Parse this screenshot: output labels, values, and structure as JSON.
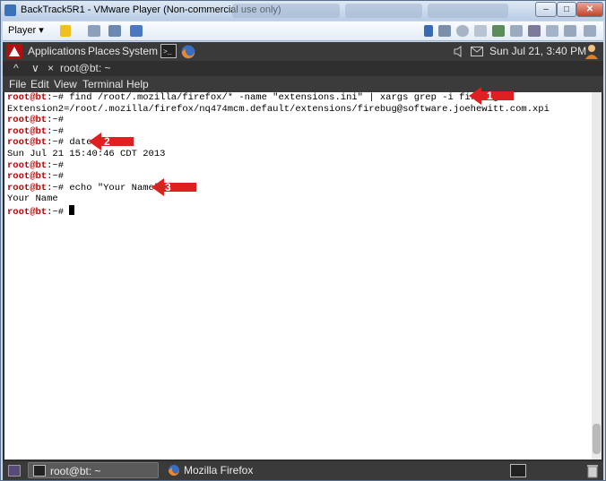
{
  "window": {
    "title": "BackTrack5R1 - VMware Player (Non-commercial use only)",
    "buttons": {
      "minimize": "–",
      "maximize": "□",
      "close": "✕"
    }
  },
  "vmware_toolbar": {
    "player_label": "Player ▾"
  },
  "gnome_panel": {
    "menus": [
      "Applications",
      "Places",
      "System"
    ],
    "datetime": "Sun Jul 21,  3:40 PM"
  },
  "terminal": {
    "title": "root@bt: ~",
    "title_controls": [
      "^",
      "∨",
      "×"
    ],
    "menu": [
      "File",
      "Edit",
      "View",
      "Terminal",
      "Help"
    ],
    "prompt_user": "root@bt",
    "prompt_path": ":~# ",
    "lines": [
      {
        "type": "cmd",
        "text": "find /root/.mozilla/firefox/* -name \"extensions.ini\" | xargs grep -i firebug"
      },
      {
        "type": "out",
        "text": "Extension2=/root/.mozilla/firefox/nq474mcm.default/extensions/firebug@software.joehewitt.com.xpi"
      },
      {
        "type": "cmd",
        "text": ""
      },
      {
        "type": "cmd",
        "text": ""
      },
      {
        "type": "cmd",
        "text": "date"
      },
      {
        "type": "out",
        "text": "Sun Jul 21 15:40:46 CDT 2013"
      },
      {
        "type": "cmd",
        "text": ""
      },
      {
        "type": "cmd",
        "text": ""
      },
      {
        "type": "cmd",
        "text": "echo \"Your Name\""
      },
      {
        "type": "out",
        "text": "Your Name"
      },
      {
        "type": "cmd",
        "text": "",
        "cursor": true
      }
    ]
  },
  "annotations": [
    {
      "label": "1",
      "color": "#e02020"
    },
    {
      "label": "2",
      "color": "#e02020"
    },
    {
      "label": "3",
      "color": "#e02020"
    }
  ],
  "taskbar": {
    "tasks": [
      {
        "label": "root@bt: ~",
        "active": true
      },
      {
        "label": "Mozilla Firefox",
        "active": false
      }
    ]
  }
}
